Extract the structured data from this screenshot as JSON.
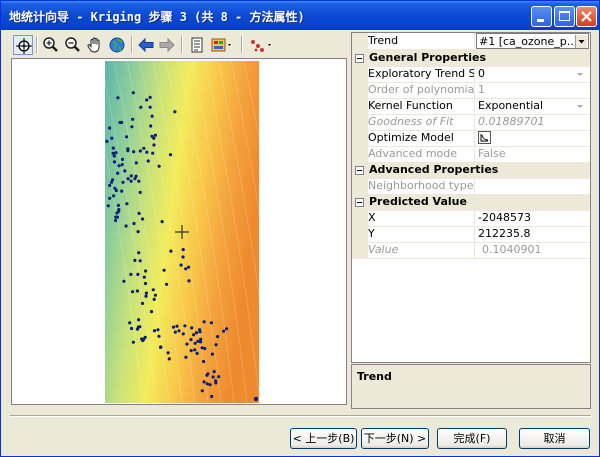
{
  "window": {
    "title": "地统计向导 - Kriging 步骤 3 (共 8 - 方法属性)",
    "minimize_icon": "minimize-icon",
    "maximize_icon": "maximize-icon",
    "close_icon": "close-icon"
  },
  "toolbar": {
    "tools": [
      "pan-crosshair-icon",
      "zoom-in-icon",
      "zoom-out-icon",
      "pan-hand-icon",
      "full-extent-globe-icon",
      "back-arrow-icon",
      "forward-arrow-icon",
      "layers-icon",
      "legend-icon",
      "points-options-icon"
    ]
  },
  "map": {
    "gradient_colors": [
      "#5fb8a8",
      "#8fcf9a",
      "#c8e27a",
      "#f2ec5a",
      "#f8c84a",
      "#f4a23c",
      "#ee8a2e"
    ],
    "point_color": "#0a1e7a"
  },
  "properties": {
    "trend": {
      "label": "Trend",
      "value": "#1 [ca_ozone_p.…"
    },
    "general": {
      "title": "General Properties",
      "exploratory_label": "Exploratory Trend S…",
      "exploratory_value": "0",
      "order_label": "Order of polynomial",
      "order_value": "1",
      "kernel_label": "Kernel Function",
      "kernel_value": "Exponential",
      "goodness_label": "Goodness of Fit",
      "goodness_value": "0.01889701",
      "optimize_label": "Optimize Model",
      "advanced_label": "Advanced mode",
      "advanced_value": "False"
    },
    "advanced": {
      "title": "Advanced Properties",
      "neighborhood_label": "Neighborhood type",
      "neighborhood_value": ""
    },
    "predicted": {
      "title": "Predicted Value",
      "x_label": "X",
      "x_value": "-2048573",
      "y_label": "Y",
      "y_value": "212235.8",
      "value_label": "Value",
      "value_value": "0.1040901"
    }
  },
  "description": {
    "title": "Trend"
  },
  "buttons": {
    "back": "< 上一步(B)",
    "next": "下一步(N) >",
    "finish": "完成(F)",
    "cancel": "取消"
  }
}
